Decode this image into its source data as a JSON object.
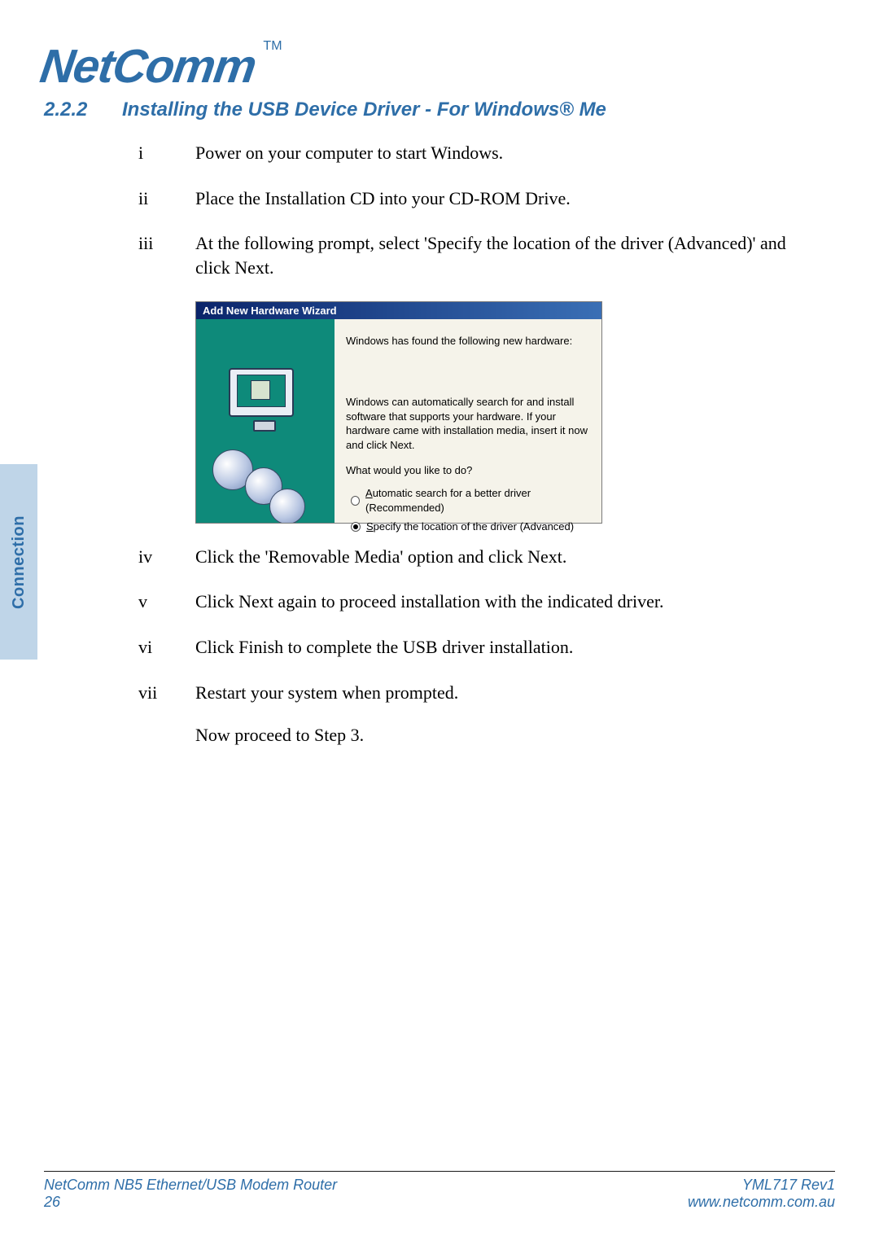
{
  "logo": {
    "name": "NetComm",
    "tm": "TM"
  },
  "section": {
    "number": "2.2.2",
    "title": "Installing the USB Device Driver - For Windows® Me"
  },
  "side_tab": "Connection",
  "steps": [
    {
      "num": "i",
      "text": "Power on your computer to start Windows."
    },
    {
      "num": "ii",
      "text": "Place the Installation CD into your CD-ROM Drive."
    },
    {
      "num": "iii",
      "text": "At the following prompt, select 'Specify the location of the driver (Advanced)' and click Next."
    },
    {
      "num": "iv",
      "text": "Click the 'Removable Media' option and click Next."
    },
    {
      "num": "v",
      "text": "Click Next again to proceed installation with the indicated driver."
    },
    {
      "num": "vi",
      "text": "Click Finish to complete the USB driver installation."
    },
    {
      "num": "vii",
      "text": "Restart your system when prompted."
    }
  ],
  "proceed": "Now proceed to Step 3.",
  "wizard": {
    "title": "Add New Hardware Wizard",
    "found": "Windows has found the following new hardware:",
    "desc": "Windows can automatically search for and install software that supports your hardware. If your hardware came with installation media, insert it now and click Next.",
    "prompt": "What would you like to do?",
    "option_auto_prefix_u": "A",
    "option_auto_rest": "utomatic search for a better driver (Recommended)",
    "option_spec_prefix_u": "S",
    "option_spec_rest": "pecify the location of the driver (Advanced)"
  },
  "footer": {
    "left_line1": "NetComm NB5 Ethernet/USB Modem Router",
    "left_line2": "26",
    "right_line1": "YML717 Rev1",
    "right_line2": "www.netcomm.com.au"
  }
}
